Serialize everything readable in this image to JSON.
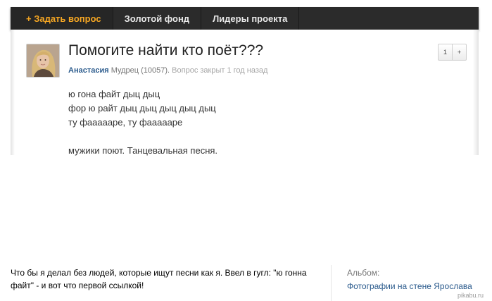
{
  "nav": {
    "items": [
      {
        "label": "+ Задать вопрос"
      },
      {
        "label": "Золотой фонд"
      },
      {
        "label": "Лидеры проекта"
      }
    ]
  },
  "question": {
    "title": "Помогите найти кто поёт???",
    "author": "Анастасия",
    "rank": "Мудрец (10057).",
    "status": "Вопрос закрыт 1 год назад",
    "vote_count": "1",
    "vote_plus": "+",
    "body_lines": [
      "ю гона файт дыц дыц",
      "фор ю райт дыц дыц дыц дыц дыц",
      "ту фаааааре, ту фаааааре",
      "мужики поют. Танцевальная песня."
    ]
  },
  "comment": {
    "text": "Что бы я делал без людей, которые ищут песни как я. Ввел в гугл: \"ю гонна файт\" - и вот что первой ссылкой!"
  },
  "album": {
    "label": "Альбом:",
    "link": "Фотографии на стене Ярослава"
  },
  "watermark": "pikabu.ru",
  "colors": {
    "nav_bg": "#2b2b2b",
    "ask_accent": "#f5a623",
    "link": "#2a5a8c"
  }
}
